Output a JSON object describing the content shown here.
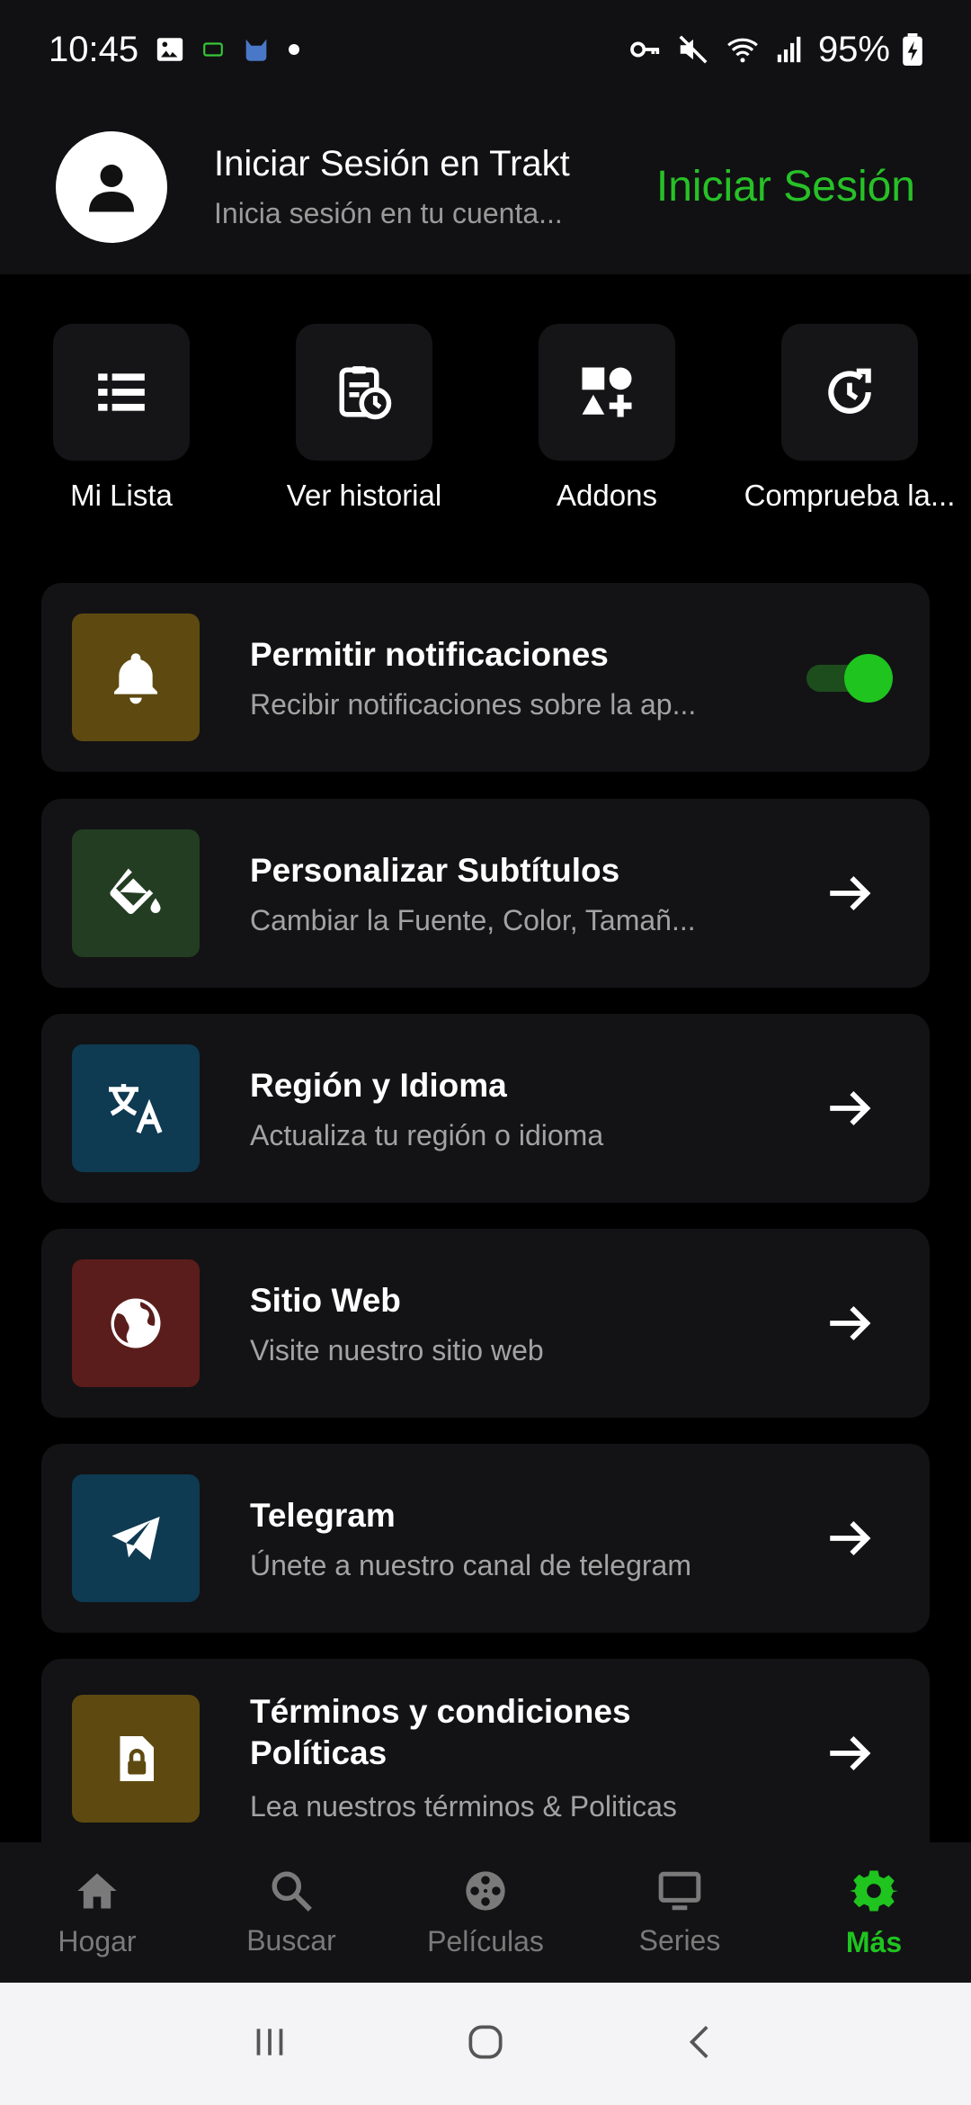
{
  "status_bar": {
    "time": "10:45",
    "battery": "95%"
  },
  "header": {
    "title": "Iniciar Sesión en Trakt",
    "subtitle": "Inicia sesión en tu cuenta...",
    "login_button": "Iniciar Sesión"
  },
  "quick_actions": [
    {
      "label": "Mi Lista",
      "icon": "list-icon"
    },
    {
      "label": "Ver historial",
      "icon": "history-clipboard-icon"
    },
    {
      "label": "Addons",
      "icon": "shapes-add-icon"
    },
    {
      "label": "Comprueba la...",
      "icon": "update-clock-icon"
    }
  ],
  "settings": [
    {
      "title": "Permitir notificaciones",
      "subtitle": "Recibir notificaciones sobre la ap...",
      "icon": "bell-icon",
      "icon_bg": "#5e4a10",
      "action": "toggle",
      "enabled": true
    },
    {
      "title": "Personalizar Subtítulos",
      "subtitle": "Cambiar la Fuente, Color, Tamañ...",
      "icon": "paint-bucket-icon",
      "icon_bg": "#233d22",
      "action": "arrow"
    },
    {
      "title": "Región y Idioma",
      "subtitle": "Actualiza tu región o idioma",
      "icon": "translate-icon",
      "icon_bg": "#0e3a52",
      "action": "arrow"
    },
    {
      "title": "Sitio Web",
      "subtitle": "Visite nuestro sitio web",
      "icon": "globe-icon",
      "icon_bg": "#5a1d1b",
      "action": "arrow"
    },
    {
      "title": "Telegram",
      "subtitle": "Únete a nuestro canal de telegram",
      "icon": "telegram-icon",
      "icon_bg": "#0e3a52",
      "action": "arrow"
    },
    {
      "title": "Términos y condiciones Políticas",
      "subtitle": "Lea nuestros términos & Politicas",
      "icon": "document-lock-icon",
      "icon_bg": "#5e4a10",
      "action": "arrow"
    }
  ],
  "bottom_nav": [
    {
      "label": "Hogar",
      "icon": "home-icon",
      "active": false
    },
    {
      "label": "Buscar",
      "icon": "search-icon",
      "active": false
    },
    {
      "label": "Películas",
      "icon": "film-reel-icon",
      "active": false
    },
    {
      "label": "Series",
      "icon": "tv-icon",
      "active": false
    },
    {
      "label": "Más",
      "icon": "gear-icon",
      "active": true
    }
  ],
  "colors": {
    "accent": "#1fc41f",
    "background": "#000000",
    "card": "#131315"
  }
}
